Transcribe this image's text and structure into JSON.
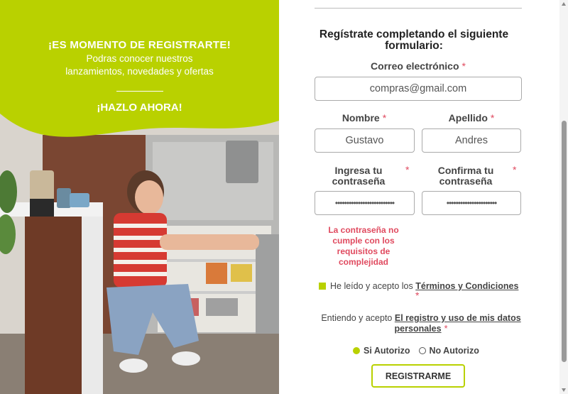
{
  "promo": {
    "title": "¡ES MOMENTO DE REGISTRARTE!",
    "subtitle_line1": "Podras conocer nuestros",
    "subtitle_line2": "lanzamientos, novedades y ofertas",
    "cta": "¡HAZLO AHORA!"
  },
  "form": {
    "title": "Regístrate completando el siguiente formulario:",
    "required_mark": "*",
    "email": {
      "label": "Correo electrónico",
      "value": "compras@gmail.com"
    },
    "first_name": {
      "label": "Nombre",
      "value": "Gustavo"
    },
    "last_name": {
      "label": "Apellido",
      "value": "Andres"
    },
    "password": {
      "label_line1": "Ingresa tu",
      "label_line2": "contraseña",
      "value": "••••••••••••••••••••••••••"
    },
    "confirm_password": {
      "label_line1": "Confirma tu",
      "label_line2": "contraseña",
      "value": "••••••••••••••••••••••"
    },
    "error": "La contraseña no cumple con los requisitos de complejidad",
    "terms_prefix": "He leído y acepto los ",
    "terms_link": "Términos y Condiciones",
    "consent_prefix": "Entiendo y acepto ",
    "consent_link_line1": "El registro y uso de mis datos",
    "consent_link_line2": "personales",
    "radio_yes": "Si Autorizo",
    "radio_no": "No Autorizo",
    "submit": "REGISTRARME"
  },
  "colors": {
    "brand_green": "#b9d100",
    "error_red": "#e04a5f"
  }
}
